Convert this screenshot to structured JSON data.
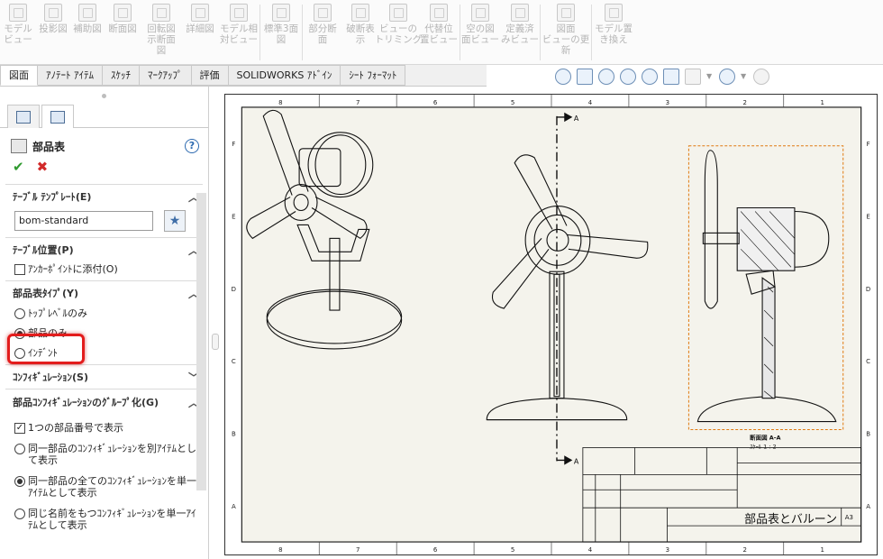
{
  "ribbon": {
    "buttons": [
      {
        "label": "モデル\nビュー",
        "icon": "model-view-icon"
      },
      {
        "label": "投影図",
        "icon": "projected-view-icon"
      },
      {
        "label": "補助図",
        "icon": "auxiliary-view-icon"
      },
      {
        "label": "断面図",
        "icon": "section-view-icon"
      },
      {
        "label": "回転図\n示断面\n図",
        "icon": "removed-section-icon"
      },
      {
        "label": "詳細図",
        "icon": "detail-view-icon"
      },
      {
        "label": "モデル相\n対ビュー",
        "icon": "relative-view-icon"
      },
      {
        "label": "標準3面\n図",
        "icon": "standard-3-view-icon"
      },
      {
        "label": "部分断\n面",
        "icon": "broken-out-section-icon"
      },
      {
        "label": "破断表\n示",
        "icon": "break-icon"
      },
      {
        "label": "ビューの\nトリミング",
        "icon": "crop-view-icon"
      },
      {
        "label": "代替位\n置ビュー",
        "icon": "alternate-position-icon"
      },
      {
        "label": "空の図\n面ビュー",
        "icon": "empty-view-icon"
      },
      {
        "label": "定義済\nみビュー",
        "icon": "predefined-view-icon"
      },
      {
        "label": "図面\nビューの更\n新",
        "icon": "update-view-icon"
      },
      {
        "label": "モデル置\nき換え",
        "icon": "replace-model-icon"
      }
    ]
  },
  "tabs": [
    "図面",
    "ｱﾉﾃｰﾄ ｱｲﾃﾑ",
    "ｽｹｯﾁ",
    "ﾏｰｸｱｯﾌﾟ",
    "評価",
    "SOLIDWORKS ｱﾄﾞｲﾝ",
    "ｼｰﾄ ﾌｫｰﾏｯﾄ"
  ],
  "panel": {
    "title": "部品表",
    "groups": {
      "template": {
        "label": "ﾃｰﾌﾞﾙ ﾃﾝﾌﾟﾚｰﾄ(E)",
        "value": "bom-standard"
      },
      "position": {
        "label": "ﾃｰﾌﾞﾙ位置(P)",
        "anchor": "ｱﾝｶｰﾎﾟｲﾝﾄに添付(O)"
      },
      "bomtype": {
        "label": "部品表ﾀｲﾌﾟ(Y)",
        "options": [
          "ﾄｯﾌﾟﾚﾍﾞﾙのみ",
          "部品のみ",
          "ｲﾝﾃﾞﾝﾄ"
        ],
        "selected": 1
      },
      "config": {
        "label": "ｺﾝﾌｨｷﾞｭﾚｰｼｮﾝ(S)"
      },
      "grouping": {
        "label": "部品ｺﾝﾌｨｷﾞｭﾚｰｼｮﾝのｸﾞﾙｰﾌﾟ化(G)",
        "checkbox": "1つの部品番号で表示",
        "options": [
          "同一部品のｺﾝﾌｨｷﾞｭﾚｰｼｮﾝを別ｱｲﾃﾑとして表示",
          "同一部品の全てのｺﾝﾌｨｷﾞｭﾚｰｼｮﾝを単一ｱｲﾃﾑとして表示",
          "同じ名前をもつｺﾝﾌｨｷﾞｭﾚｰｼｮﾝを単一ｱｲﾃﾑとして表示"
        ],
        "selected": 1
      }
    }
  },
  "drawing": {
    "columns": [
      "8",
      "7",
      "6",
      "5",
      "4",
      "3",
      "2",
      "1"
    ],
    "rows": [
      "F",
      "E",
      "D",
      "C",
      "B",
      "A"
    ],
    "section_label": "A",
    "section_caption": "断面図 A-A",
    "section_scale": "ｽｹｰﾙ 1 : 2",
    "title_block_name": "部品表とバルーン",
    "sheet_size": "A3"
  }
}
